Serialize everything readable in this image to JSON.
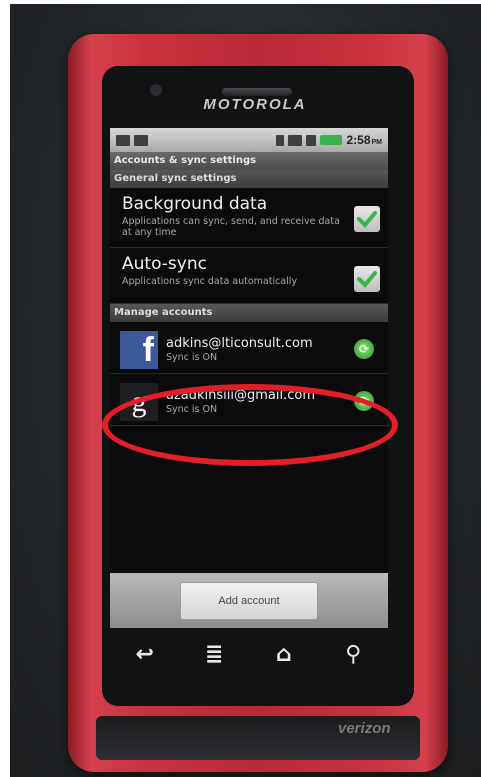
{
  "device": {
    "brand": "MOTOROLA",
    "carrier": "verizon"
  },
  "statusbar": {
    "time": "2:58",
    "time_suffix": "PM",
    "battery_color": "#38b24a"
  },
  "screen": {
    "title": "Accounts & sync settings",
    "general_header": "General sync settings",
    "background_data": {
      "title": "Background data",
      "summary": "Applications can sync, send, and receive data at any time",
      "checked": true
    },
    "auto_sync": {
      "title": "Auto-sync",
      "summary": "Applications sync data automatically",
      "checked": true
    },
    "manage_header": "Manage accounts",
    "accounts": [
      {
        "icon": "facebook-icon",
        "glyph": "f",
        "email": "adkins@lticonsult.com",
        "status": "Sync is ON"
      },
      {
        "icon": "google-icon",
        "glyph": "g",
        "email": "azadkinsiii@gmail.com",
        "status": "Sync is ON"
      }
    ],
    "add_account_label": "Add account"
  },
  "highlight_color": "#e21f26",
  "keys": {
    "back": "↩",
    "menu": "≣",
    "home": "⌂",
    "search": "⚲"
  }
}
